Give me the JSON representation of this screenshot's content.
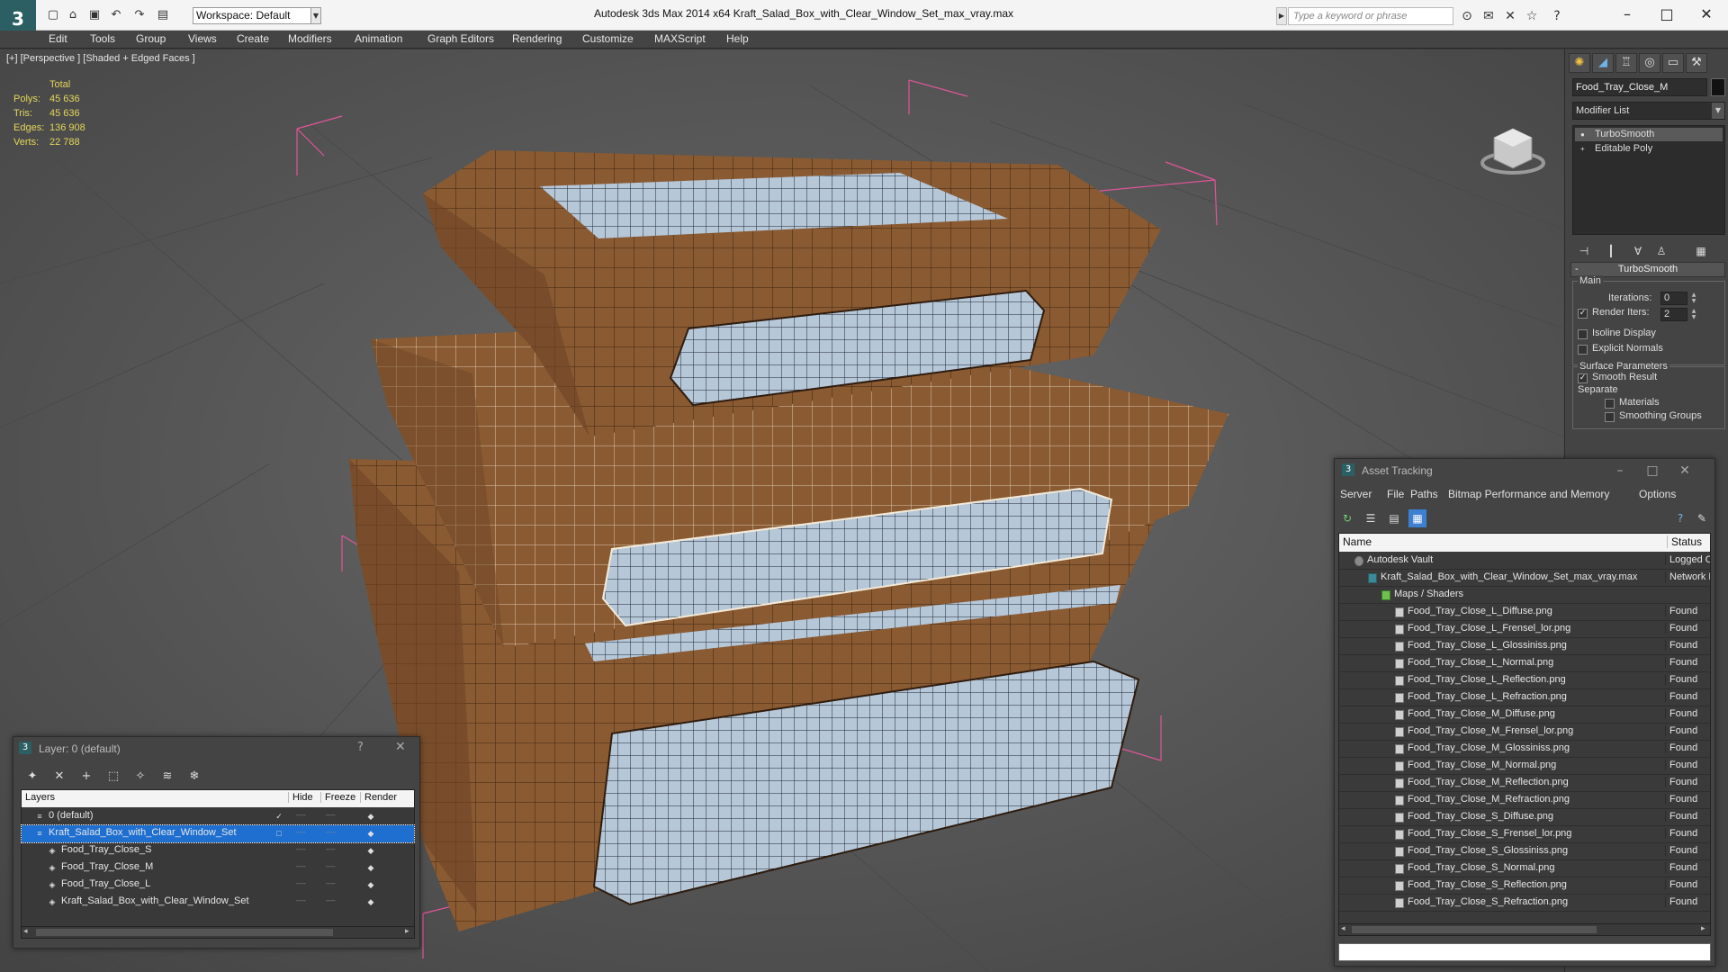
{
  "app": {
    "title": "Autodesk 3ds Max  2014 x64      Kraft_Salad_Box_with_Clear_Window_Set_max_vray.max",
    "logo_glyph": "3",
    "workspace": "Workspace: Default",
    "search_placeholder": "Type a keyword or phrase"
  },
  "menubar": [
    "Edit",
    "Tools",
    "Group",
    "Views",
    "Create",
    "Modifiers",
    "Animation",
    "Graph Editors",
    "Rendering",
    "Customize",
    "MAXScript",
    "Help"
  ],
  "viewport": {
    "label": "[+] [Perspective ] [Shaded + Edged Faces ]",
    "stats": {
      "header": "Total",
      "rows": [
        {
          "label": "Polys:",
          "value": "45 636"
        },
        {
          "label": "Tris:",
          "value": "45 636"
        },
        {
          "label": "Edges:",
          "value": "136 908"
        },
        {
          "label": "Verts:",
          "value": "22 788"
        }
      ]
    },
    "colors": {
      "box": "#8a5a32",
      "box_dark": "#6e4526",
      "window": "#b6c7d8",
      "bbox": "#e0559a"
    }
  },
  "command_panel": {
    "object_name": "Food_Tray_Close_M",
    "modifier_list": "Modifier List",
    "stack": [
      "TurboSmooth",
      "Editable Poly"
    ],
    "rollout_title": "TurboSmooth",
    "main_group": "Main",
    "iterations_label": "Iterations:",
    "iterations_value": "0",
    "render_iters_label": "Render Iters:",
    "render_iters_value": "2",
    "isoline_label": "Isoline Display",
    "explicit_normals_label": "Explicit Normals",
    "surface_group": "Surface Parameters",
    "smooth_result_label": "Smooth Result",
    "separate_label": "Separate",
    "materials_label": "Materials",
    "smoothing_groups_label": "Smoothing Groups"
  },
  "asset_tracking": {
    "title": "Asset Tracking",
    "menu": [
      "Server",
      "File",
      "Paths",
      "Bitmap Performance and Memory",
      "Options"
    ],
    "columns": {
      "name": "Name",
      "status": "Status"
    },
    "rows": [
      {
        "name": "Autodesk Vault",
        "status": "Logged O",
        "indent": 1,
        "icon": "vault-icon"
      },
      {
        "name": "Kraft_Salad_Box_with_Clear_Window_Set_max_vray.max",
        "status": "Network P",
        "indent": 2,
        "icon": "max-file-icon"
      },
      {
        "name": "Maps / Shaders",
        "status": "",
        "indent": 3,
        "icon": "maps-icon"
      },
      {
        "name": "Food_Tray_Close_L_Diffuse.png",
        "status": "Found",
        "indent": 4,
        "icon": "image-file-icon"
      },
      {
        "name": "Food_Tray_Close_L_Frensel_lor.png",
        "status": "Found",
        "indent": 4,
        "icon": "image-file-icon"
      },
      {
        "name": "Food_Tray_Close_L_Glossiniss.png",
        "status": "Found",
        "indent": 4,
        "icon": "image-file-icon"
      },
      {
        "name": "Food_Tray_Close_L_Normal.png",
        "status": "Found",
        "indent": 4,
        "icon": "image-file-icon"
      },
      {
        "name": "Food_Tray_Close_L_Reflection.png",
        "status": "Found",
        "indent": 4,
        "icon": "image-file-icon"
      },
      {
        "name": "Food_Tray_Close_L_Refraction.png",
        "status": "Found",
        "indent": 4,
        "icon": "image-file-icon"
      },
      {
        "name": "Food_Tray_Close_M_Diffuse.png",
        "status": "Found",
        "indent": 4,
        "icon": "image-file-icon"
      },
      {
        "name": "Food_Tray_Close_M_Frensel_lor.png",
        "status": "Found",
        "indent": 4,
        "icon": "image-file-icon"
      },
      {
        "name": "Food_Tray_Close_M_Glossiniss.png",
        "status": "Found",
        "indent": 4,
        "icon": "image-file-icon"
      },
      {
        "name": "Food_Tray_Close_M_Normal.png",
        "status": "Found",
        "indent": 4,
        "icon": "image-file-icon"
      },
      {
        "name": "Food_Tray_Close_M_Reflection.png",
        "status": "Found",
        "indent": 4,
        "icon": "image-file-icon"
      },
      {
        "name": "Food_Tray_Close_M_Refraction.png",
        "status": "Found",
        "indent": 4,
        "icon": "image-file-icon"
      },
      {
        "name": "Food_Tray_Close_S_Diffuse.png",
        "status": "Found",
        "indent": 4,
        "icon": "image-file-icon"
      },
      {
        "name": "Food_Tray_Close_S_Frensel_lor.png",
        "status": "Found",
        "indent": 4,
        "icon": "image-file-icon"
      },
      {
        "name": "Food_Tray_Close_S_Glossiniss.png",
        "status": "Found",
        "indent": 4,
        "icon": "image-file-icon"
      },
      {
        "name": "Food_Tray_Close_S_Normal.png",
        "status": "Found",
        "indent": 4,
        "icon": "image-file-icon"
      },
      {
        "name": "Food_Tray_Close_S_Reflection.png",
        "status": "Found",
        "indent": 4,
        "icon": "image-file-icon"
      },
      {
        "name": "Food_Tray_Close_S_Refraction.png",
        "status": "Found",
        "indent": 4,
        "icon": "image-file-icon"
      }
    ]
  },
  "layer_manager": {
    "title": "Layer: 0 (default)",
    "help_glyph": "?",
    "columns": {
      "layers": "Layers",
      "hide": "Hide",
      "freeze": "Freeze",
      "render": "Render"
    },
    "rows": [
      {
        "name": "0 (default)",
        "indent": 1,
        "selected": false,
        "current": true
      },
      {
        "name": "Kraft_Salad_Box_with_Clear_Window_Set",
        "indent": 1,
        "selected": true,
        "current": false
      },
      {
        "name": "Food_Tray_Close_S",
        "indent": 2,
        "selected": false,
        "current": false
      },
      {
        "name": "Food_Tray_Close_M",
        "indent": 2,
        "selected": false,
        "current": false
      },
      {
        "name": "Food_Tray_Close_L",
        "indent": 2,
        "selected": false,
        "current": false
      },
      {
        "name": "Kraft_Salad_Box_with_Clear_Window_Set",
        "indent": 2,
        "selected": false,
        "current": false
      }
    ]
  }
}
